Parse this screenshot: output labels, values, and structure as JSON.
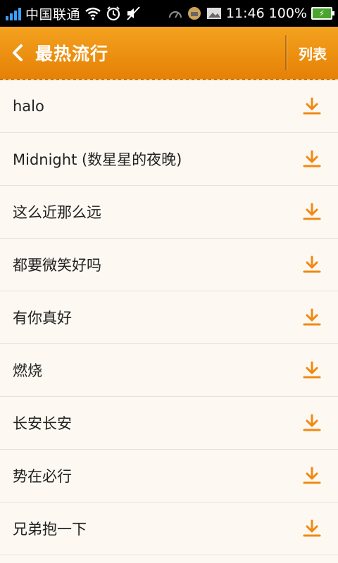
{
  "status_bar": {
    "carrier": "中国联通",
    "time": "11:46",
    "battery": "100%",
    "icons": [
      "signal-icon",
      "wifi-icon",
      "alarm-icon",
      "mute-icon",
      "speed-icon",
      "android-icon",
      "image-icon",
      "battery-charging-icon"
    ]
  },
  "header": {
    "back_icon": "chevron-left-icon",
    "title": "最热流行",
    "list_button": "列表",
    "bg_color": "#f08f12"
  },
  "songs": [
    {
      "title": "halo"
    },
    {
      "title": "Midnight (数星星的夜晚)"
    },
    {
      "title": "这么近那么远"
    },
    {
      "title": "都要微笑好吗"
    },
    {
      "title": "有你真好"
    },
    {
      "title": "燃烧"
    },
    {
      "title": "长安长安"
    },
    {
      "title": "势在必行"
    },
    {
      "title": "兄弟抱一下"
    }
  ],
  "download_icon": "download-icon",
  "accent_color": "#ef8a12"
}
